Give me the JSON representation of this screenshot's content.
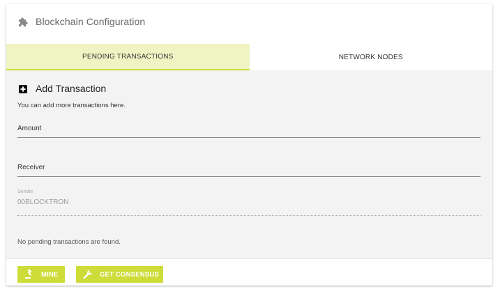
{
  "header": {
    "icon": "puzzle-piece-icon",
    "title": "Blockchain Configuration"
  },
  "tabs": [
    {
      "label": "PENDING TRANSACTIONS",
      "active": true
    },
    {
      "label": "NETWORK NODES",
      "active": false
    }
  ],
  "add_transaction": {
    "icon": "plus-square-icon",
    "title": "Add Transaction",
    "subtitle": "You can add more transactions here."
  },
  "form": {
    "amount_label": "Amount",
    "amount_value": "",
    "receiver_label": "Receiver",
    "receiver_value": "",
    "sender_label": "Sender",
    "sender_value": "00BLOCKTRON"
  },
  "status": {
    "empty_message": "No pending transactions are found."
  },
  "actions": {
    "mine_label": "MINE",
    "mine_icon": "gavel-icon",
    "consensus_label": "GET CONSENSUS",
    "consensus_icon": "wrench-icon"
  },
  "colors": {
    "accent": "#cddc39",
    "tab_active_bg": "#eff4c2",
    "panel_bg": "#f3f3f3"
  }
}
